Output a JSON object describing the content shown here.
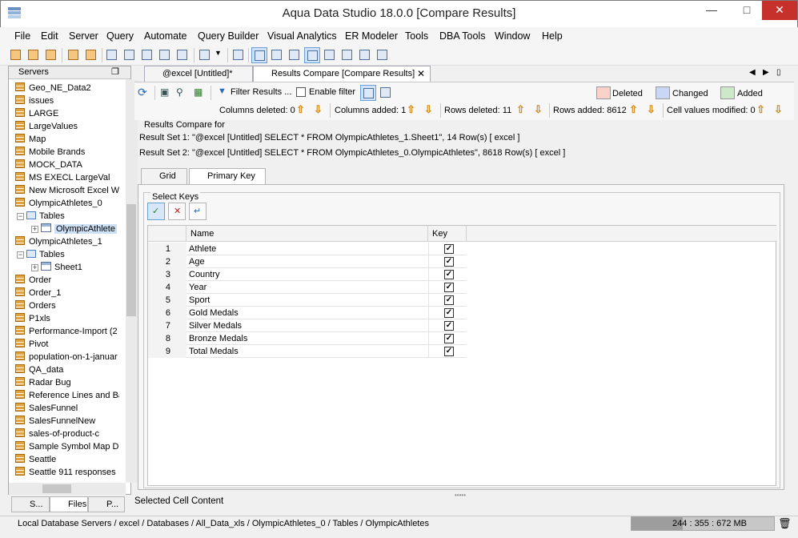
{
  "window": {
    "title": "Aqua Data Studio 18.0.0 [Compare Results]"
  },
  "menu": [
    "File",
    "Edit",
    "Server",
    "Query",
    "Automate",
    "Query Builder",
    "Visual Analytics",
    "ER Modeler",
    "Tools",
    "DBA Tools",
    "Window",
    "Help"
  ],
  "left_panel": {
    "header": "Servers",
    "tree": [
      {
        "label": "Geo_NE_Data2",
        "type": "db",
        "indent": 0
      },
      {
        "label": "issues",
        "type": "db",
        "indent": 0
      },
      {
        "label": "LARGE",
        "type": "db",
        "indent": 0
      },
      {
        "label": "LargeValues",
        "type": "db",
        "indent": 0
      },
      {
        "label": "Map",
        "type": "db",
        "indent": 0
      },
      {
        "label": "Mobile Brands",
        "type": "db",
        "indent": 0
      },
      {
        "label": "MOCK_DATA",
        "type": "db",
        "indent": 0
      },
      {
        "label": "MS EXECL LargeVal",
        "type": "db",
        "indent": 0
      },
      {
        "label": "New Microsoft Excel W",
        "type": "db",
        "indent": 0
      },
      {
        "label": "OlympicAthletes_0",
        "type": "db",
        "indent": 0
      },
      {
        "label": "Tables",
        "type": "folder",
        "indent": 1
      },
      {
        "label": "OlympicAthlete",
        "type": "table",
        "indent": 2,
        "selected": true
      },
      {
        "label": "OlympicAthletes_1",
        "type": "db",
        "indent": 0
      },
      {
        "label": "Tables",
        "type": "folder",
        "indent": 1
      },
      {
        "label": "Sheet1",
        "type": "table",
        "indent": 2
      },
      {
        "label": "Order",
        "type": "db",
        "indent": 0
      },
      {
        "label": "Order_1",
        "type": "db",
        "indent": 0
      },
      {
        "label": "Orders",
        "type": "db",
        "indent": 0
      },
      {
        "label": "P1xls",
        "type": "db",
        "indent": 0
      },
      {
        "label": "Performance-Import (2",
        "type": "db",
        "indent": 0
      },
      {
        "label": "Pivot",
        "type": "db",
        "indent": 0
      },
      {
        "label": "population-on-1-januar",
        "type": "db",
        "indent": 0
      },
      {
        "label": "QA_data",
        "type": "db",
        "indent": 0
      },
      {
        "label": "Radar Bug",
        "type": "db",
        "indent": 0
      },
      {
        "label": "Reference Lines and Ba",
        "type": "db",
        "indent": 0
      },
      {
        "label": "SalesFunnel",
        "type": "db",
        "indent": 0
      },
      {
        "label": "SalesFunnelNew",
        "type": "db",
        "indent": 0
      },
      {
        "label": "sales-of-product-c",
        "type": "db",
        "indent": 0
      },
      {
        "label": "Sample Symbol Map Da",
        "type": "db",
        "indent": 0
      },
      {
        "label": "Seattle",
        "type": "db",
        "indent": 0
      },
      {
        "label": "Seattle 911 responses",
        "type": "db",
        "indent": 0
      }
    ],
    "bottom_tabs": [
      "S...",
      "Files",
      "P..."
    ]
  },
  "doc_tabs": [
    {
      "label": "@excel [Untitled]*"
    },
    {
      "label": "Results Compare [Compare Results]"
    }
  ],
  "compare_toolbar": {
    "filter_label": "Filter Results ...",
    "enable_filter": "Enable filter",
    "legend": [
      {
        "label": "Deleted",
        "color": "#f9d2c9"
      },
      {
        "label": "Changed",
        "color": "#c9d6f5"
      },
      {
        "label": "Added",
        "color": "#cde8c9"
      }
    ],
    "columns_deleted": "Columns deleted: 0",
    "columns_added": "Columns added: 1",
    "rows_deleted": "Rows deleted: 11",
    "rows_added": "Rows added: 8612",
    "cell_values_modified": "Cell values modified: 0"
  },
  "results": {
    "heading": "Results Compare for",
    "set1": "Result Set 1: \"@excel [Untitled] SELECT * FROM OlympicAthletes_1.Sheet1\", 14 Row(s)  [ excel ]",
    "set2": "Result Set 2: \"@excel [Untitled] SELECT * FROM OlympicAthletes_0.OlympicAthletes\", 8618 Row(s)  [ excel ]"
  },
  "sub_tabs": [
    "Grid",
    "Primary Key"
  ],
  "primary_key": {
    "group_title": "Select Keys",
    "col_name": "Name",
    "col_key": "Key",
    "rows": [
      {
        "n": "1",
        "name": "Athlete",
        "key": true
      },
      {
        "n": "2",
        "name": "Age",
        "key": true
      },
      {
        "n": "3",
        "name": "Country",
        "key": true
      },
      {
        "n": "4",
        "name": "Year",
        "key": true
      },
      {
        "n": "5",
        "name": "Sport",
        "key": true
      },
      {
        "n": "6",
        "name": "Gold Medals",
        "key": true
      },
      {
        "n": "7",
        "name": "Silver Medals",
        "key": true
      },
      {
        "n": "8",
        "name": "Bronze Medals",
        "key": true
      },
      {
        "n": "9",
        "name": "Total Medals",
        "key": true
      }
    ]
  },
  "footer_label": "Selected Cell Content",
  "status": {
    "path": "Local Database Servers / excel / Databases / All_Data_xls / OlympicAthletes_0 / Tables / OlympicAthletes",
    "memory": "244 : 355 : 672 MB",
    "memory_used_fraction": 0.36
  }
}
